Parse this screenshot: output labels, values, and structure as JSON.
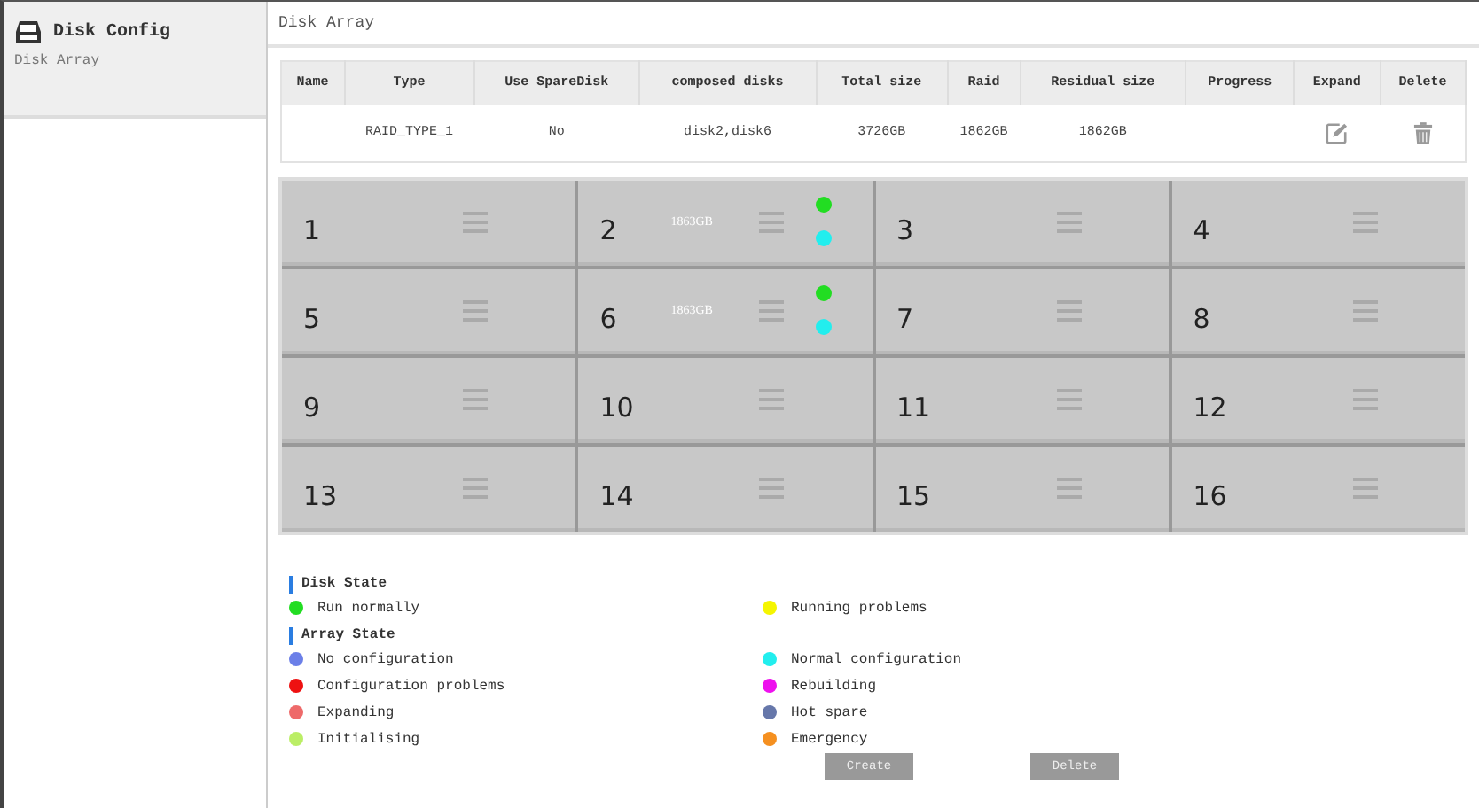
{
  "sidebar": {
    "title": "Disk Config",
    "items": [
      {
        "label": "Disk Array",
        "selected": true
      }
    ]
  },
  "page_title": "Disk Array",
  "table": {
    "columns": [
      "Name",
      "Type",
      "Use SpareDisk",
      "composed disks",
      "Total size",
      "Raid",
      "Residual size",
      "Progress",
      "Expand",
      "Delete"
    ],
    "rows": [
      {
        "name": "",
        "type": "RAID_TYPE_1",
        "use_spare_disk": "No",
        "composed_disks": "disk2,disk6",
        "total_size": "3726GB",
        "raid": "1862GB",
        "residual_size": "1862GB",
        "progress": ""
      }
    ]
  },
  "disks": [
    {
      "number": "1"
    },
    {
      "number": "2",
      "size": "1863GB",
      "indicators": [
        {
          "color": "#22dd22"
        },
        {
          "color": "#22eeee"
        }
      ]
    },
    {
      "number": "3"
    },
    {
      "number": "4"
    },
    {
      "number": "5"
    },
    {
      "number": "6",
      "size": "1863GB",
      "indicators": [
        {
          "color": "#22dd22"
        },
        {
          "color": "#22eeee"
        }
      ]
    },
    {
      "number": "7"
    },
    {
      "number": "8"
    },
    {
      "number": "9"
    },
    {
      "number": "10"
    },
    {
      "number": "11"
    },
    {
      "number": "12"
    },
    {
      "number": "13"
    },
    {
      "number": "14"
    },
    {
      "number": "15"
    },
    {
      "number": "16"
    }
  ],
  "legend": [
    {
      "title": "Disk State",
      "items": [
        {
          "label": "Run normally",
          "color": "#22dd22"
        },
        {
          "label": "Running problems",
          "color": "#f5f500"
        }
      ]
    },
    {
      "title": "Array State",
      "items": [
        {
          "label": "No configuration",
          "color": "#6b7fe8"
        },
        {
          "label": "Normal configuration",
          "color": "#22eeee"
        },
        {
          "label": "Configuration problems",
          "color": "#ee1111"
        },
        {
          "label": "Rebuilding",
          "color": "#ee11ee"
        },
        {
          "label": "Expanding",
          "color": "#ee6a6a"
        },
        {
          "label": "Hot spare",
          "color": "#6677aa"
        },
        {
          "label": "Initialising",
          "color": "#bbee66"
        },
        {
          "label": "Emergency",
          "color": "#f59020"
        }
      ]
    }
  ],
  "buttons": [
    "Create",
    "Delete"
  ]
}
